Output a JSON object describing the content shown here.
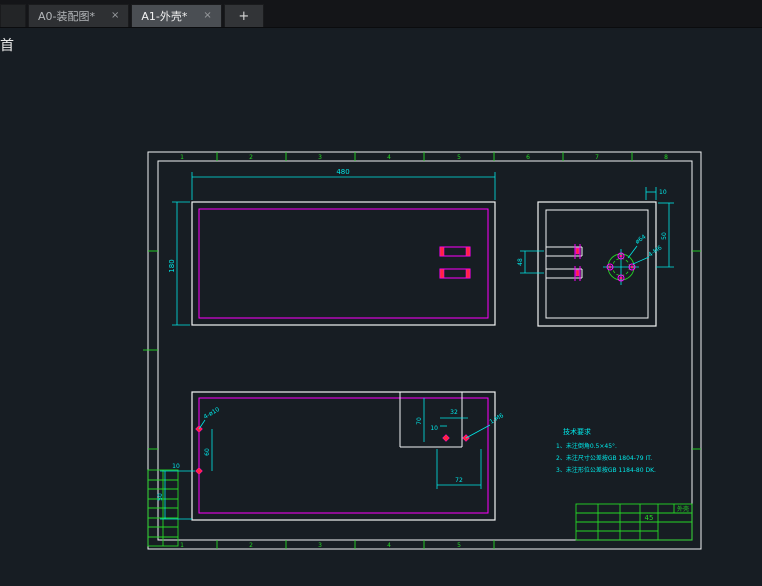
{
  "tabbar": {
    "tabs": [
      {
        "label": "A0-装配图*"
      },
      {
        "label": "A1-外壳*"
      }
    ],
    "close_glyph": "×",
    "new_tab_glyph": "+"
  },
  "canvas": {
    "corner_char": "首"
  },
  "sheet": {
    "zones": [
      "1",
      "2",
      "3",
      "4",
      "5",
      "6",
      "7",
      "8"
    ]
  },
  "views": {
    "top_left": {
      "dim_width": "480",
      "dim_height": "180"
    },
    "top_right": {
      "dim_gap": "48",
      "dim_thickness": "10",
      "dim_height": "50",
      "leader_dia": "ø64",
      "leader_holes": "4-M6"
    },
    "bottom": {
      "dim_depth": "70",
      "dim_width_inner": "32",
      "dim_offset_inner": "10",
      "dim_72": "72",
      "leader_holes": "4-ø10",
      "leader_m6": "1-M6",
      "dim_60": "60",
      "dim_50": "50",
      "dim_10_left": "10"
    }
  },
  "notes": {
    "title": "技术要求",
    "items": [
      "1、未注倒角0.5×45°.",
      "2、未注尺寸公差按GB 1804-79 IT.",
      "3、未注形位公差按GB 1184-80 DK."
    ]
  },
  "titleblock": {
    "material": "45",
    "part": "外壳"
  },
  "colors": {
    "background": "#171d23",
    "line_white": "#f2f3f4",
    "line_magenta": "#ff00ff",
    "line_cyan": "#00e8e8",
    "line_green": "#25d825",
    "accent_red": "#ff2540"
  }
}
